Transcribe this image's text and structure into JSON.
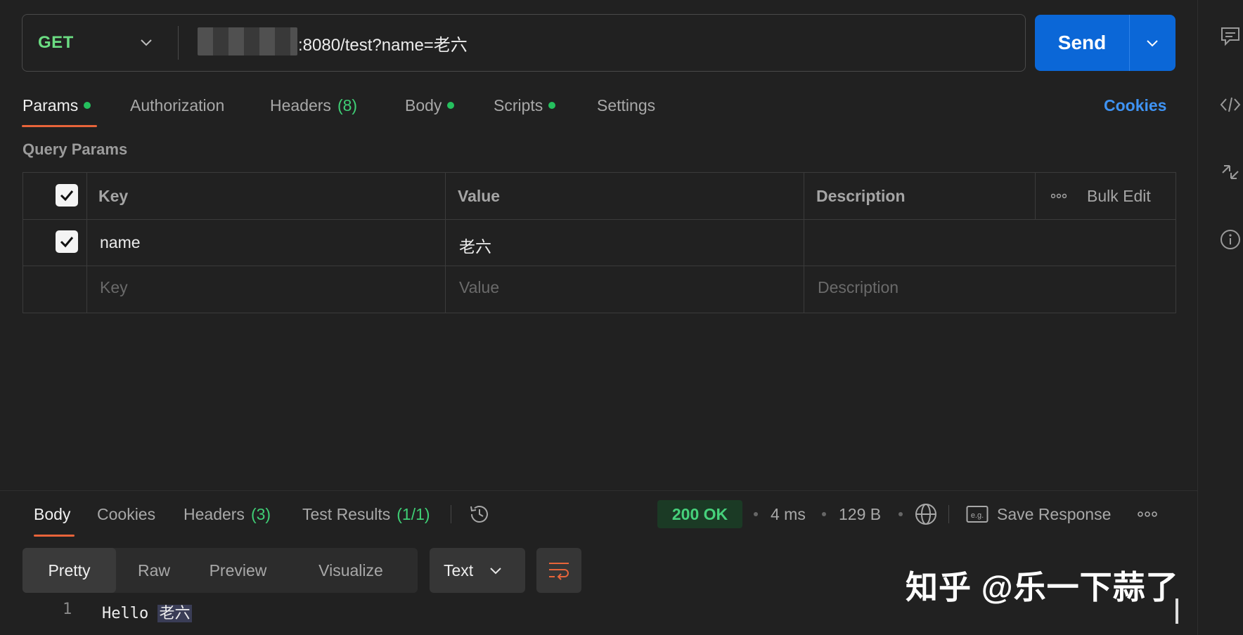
{
  "request": {
    "method": "GET",
    "url_suffix": ":8080/test?name=老六",
    "send_label": "Send"
  },
  "tabs": [
    {
      "label": "Params",
      "dot": true
    },
    {
      "label": "Authorization"
    },
    {
      "label": "Headers",
      "count": "(8)"
    },
    {
      "label": "Body",
      "dot": true
    },
    {
      "label": "Scripts",
      "dot": true
    },
    {
      "label": "Settings"
    }
  ],
  "cookies_label": "Cookies",
  "query_params": {
    "title": "Query Params",
    "headers": {
      "key": "Key",
      "value": "Value",
      "description": "Description",
      "bulk_edit": "Bulk Edit"
    },
    "rows": [
      {
        "checked": true,
        "key": "name",
        "value": "老六",
        "description": ""
      }
    ],
    "placeholder": {
      "key": "Key",
      "value": "Value",
      "description": "Description"
    }
  },
  "response": {
    "tabs": [
      {
        "label": "Body"
      },
      {
        "label": "Cookies"
      },
      {
        "label": "Headers",
        "count": "(3)"
      },
      {
        "label": "Test Results",
        "count": "(1/1)"
      }
    ],
    "status": "200 OK",
    "time": "4 ms",
    "size": "129 B",
    "save_response": "Save Response",
    "view_modes": [
      "Pretty",
      "Raw",
      "Preview",
      "Visualize"
    ],
    "format": "Text",
    "code": {
      "line_number": "1",
      "text": "Hello ",
      "highlight": "老六"
    }
  },
  "watermark": "知乎 @乐一下蒜了",
  "colors": {
    "accent": "#0b67d7",
    "method": "#6bdc82",
    "tab_underline": "#e8643a",
    "status": "#46d17b",
    "link": "#3f93f3"
  }
}
